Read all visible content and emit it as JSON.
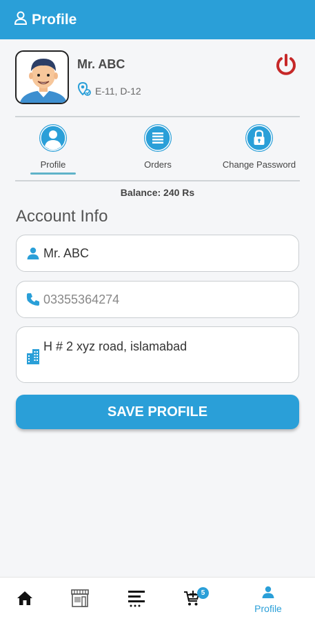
{
  "appbar": {
    "title": "Profile",
    "icon": "person-outline-icon"
  },
  "profile": {
    "name": "Mr. ABC",
    "location": "E-11, D-12"
  },
  "tabs": [
    {
      "label": "Profile",
      "icon": "person-icon",
      "active": true
    },
    {
      "label": "Orders",
      "icon": "list-icon",
      "active": false
    },
    {
      "label": "Change Password",
      "icon": "lock-icon",
      "active": false
    }
  ],
  "balance": "Balance: 240 Rs",
  "account_info": {
    "title": "Account Info",
    "name_value": "Mr. ABC",
    "phone_placeholder": "03355364274",
    "address_value": "H # 2 xyz road, islamabad"
  },
  "save_label": "SAVE PROFILE",
  "bottom_nav": {
    "items": [
      "home-icon",
      "store-icon",
      "menu-icon",
      "cart-icon",
      "person-icon"
    ],
    "cart_badge": "5",
    "profile_label": "Profile"
  },
  "colors": {
    "accent": "#2a9fd8",
    "power": "#c62828"
  }
}
